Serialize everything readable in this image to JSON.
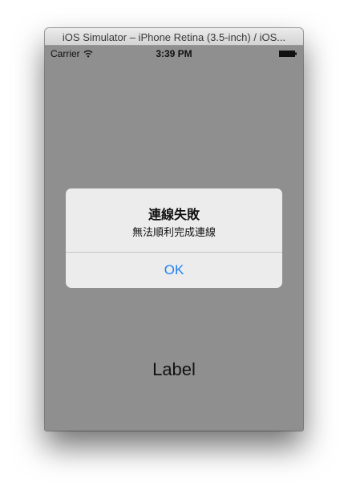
{
  "window": {
    "title": "iOS Simulator – iPhone Retina (3.5-inch) / iOS..."
  },
  "statusbar": {
    "carrier": "Carrier",
    "time": "3:39 PM"
  },
  "alert": {
    "title": "連線失敗",
    "message": "無法順利完成連線",
    "button_label": "OK"
  },
  "main": {
    "label": "Label"
  },
  "colors": {
    "screen_background": "#8f8f8f",
    "alert_background": "#ececec",
    "button_text": "#1f7ff5"
  },
  "icons": [
    "wifi-icon",
    "battery-icon"
  ]
}
